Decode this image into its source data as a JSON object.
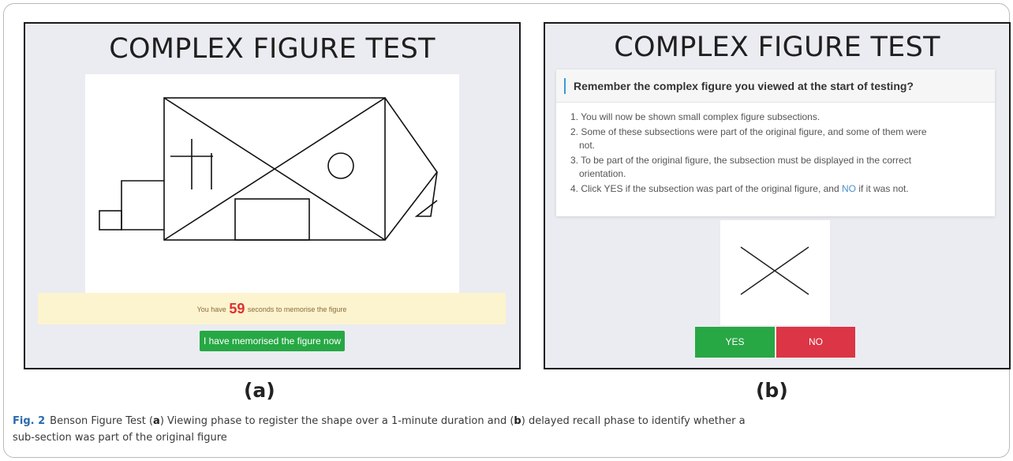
{
  "panel_a": {
    "title": "COMPLEX FIGURE TEST",
    "timer_prefix": "You have",
    "timer_seconds": "59",
    "timer_suffix": "seconds to memorise the figure",
    "memorised_button": "I have memorised the figure now",
    "label": "(a)"
  },
  "panel_b": {
    "title": "COMPLEX FIGURE TEST",
    "card_header": "Remember the complex figure you viewed at the start of testing?",
    "step1": "1. You will now be shown small complex figure subsections.",
    "step2a": "2. Some of these subsections were part of the original figure, and some of them were",
    "step2b": "not.",
    "step3a": "3. To be part of the original figure, the subsection must be displayed in the correct",
    "step3b": "orientation.",
    "step4_pre": "4. Click YES if the subsection was part of the original figure, and",
    "step4_no": "NO",
    "step4_post": "if it was not.",
    "yes_button": "YES",
    "no_button": "NO",
    "label": "(b)"
  },
  "caption": {
    "fig_label": "Fig. 2",
    "text1": "Benson Figure Test (",
    "a": "a",
    "text2": ") Viewing phase to register the shape over a 1-minute duration and (",
    "b": "b",
    "text3": ") delayed recall phase to identify whether a",
    "text4": "sub-section was part of the original figure"
  },
  "colors": {
    "panel_bg": "#ebecf1",
    "timer_bg": "#fcf3cf",
    "seconds_red": "#e03030",
    "green_button": "#26a844",
    "red_button": "#dc3545",
    "header_accent": "#3a9ad9",
    "fig_label_blue": "#2a6aad"
  }
}
